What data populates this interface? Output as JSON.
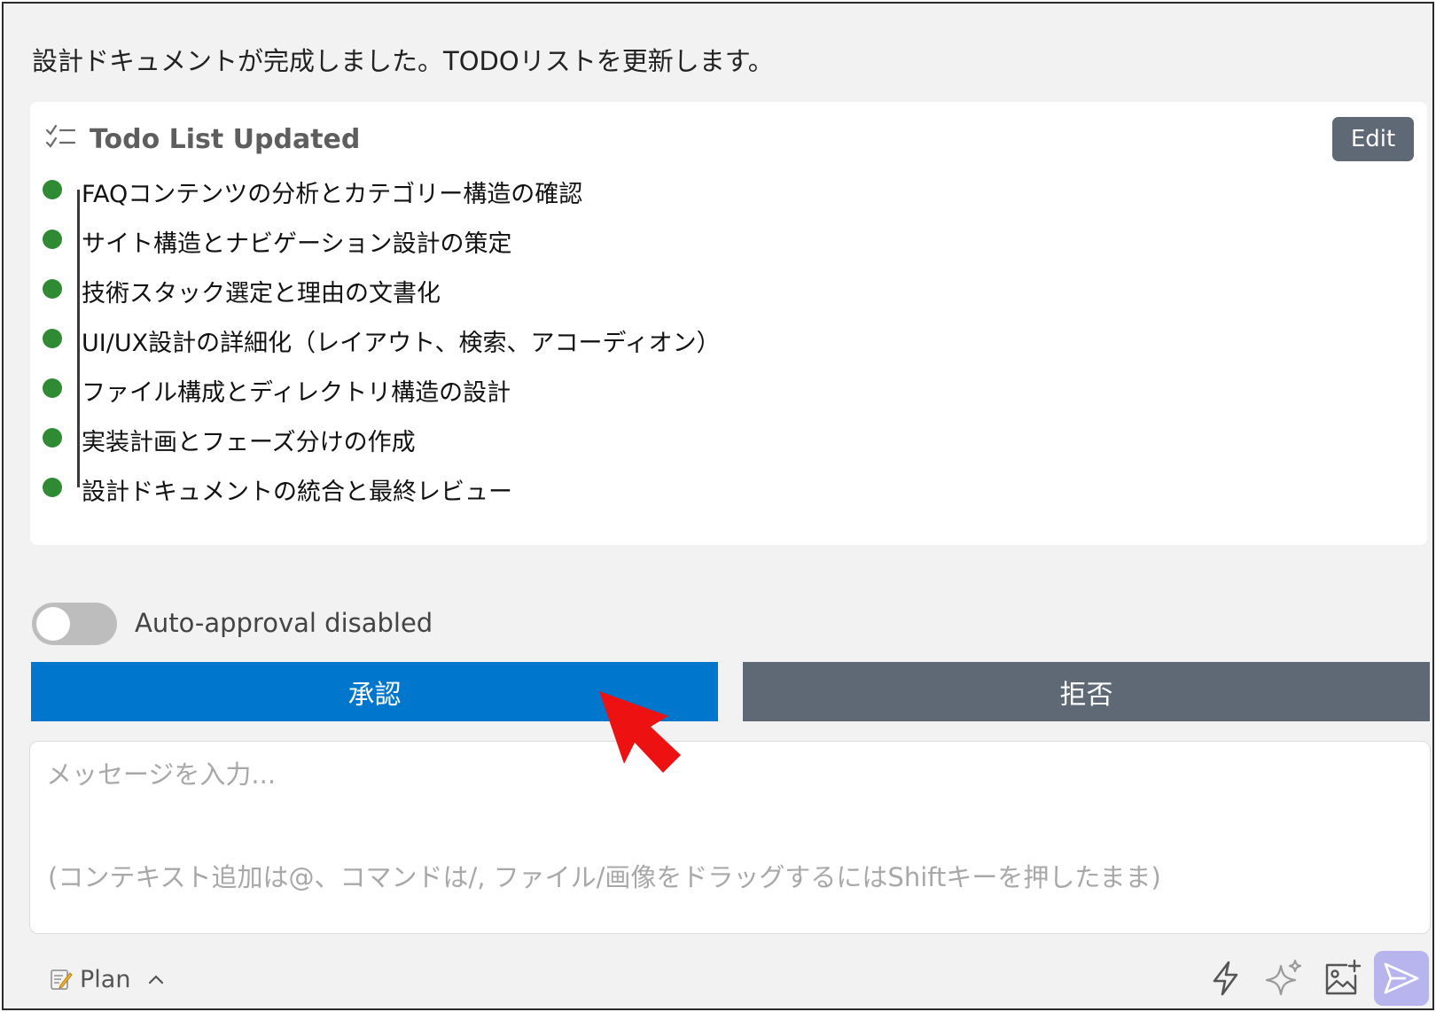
{
  "intro_message": "設計ドキュメントが完成しました。TODOリストを更新します。",
  "todo": {
    "title": "Todo List Updated",
    "edit_label": "Edit",
    "items": [
      "FAQコンテンツの分析とカテゴリー構造の確認",
      "サイト構造とナビゲーション設計の策定",
      "技術スタック選定と理由の文書化",
      "UI/UX設計の詳細化（レイアウト、検索、アコーディオン）",
      "ファイル構成とディレクトリ構造の設計",
      "実装計画とフェーズ分けの作成",
      "設計ドキュメントの統合と最終レビュー"
    ],
    "status_color": "#2e8b34"
  },
  "auto_approval": {
    "label": "Auto-approval disabled",
    "enabled": false
  },
  "actions": {
    "approve_label": "承認",
    "reject_label": "拒否",
    "approve_color": "#0077cc",
    "reject_color": "#5f6976"
  },
  "message": {
    "placeholder": "メッセージを入力...",
    "hint": "(コンテキスト追加は@、コマンドは/, ファイル/画像をドラッグするにはShiftキーを押したまま)"
  },
  "footer": {
    "mode_label": "Plan",
    "icons": [
      "memo-icon",
      "chevron-up-icon",
      "lightning-icon",
      "sparkle-icon",
      "add-image-icon",
      "send-icon"
    ]
  },
  "annotation": {
    "icon": "red-pointer-arrow-icon",
    "color": "#ee1111"
  }
}
